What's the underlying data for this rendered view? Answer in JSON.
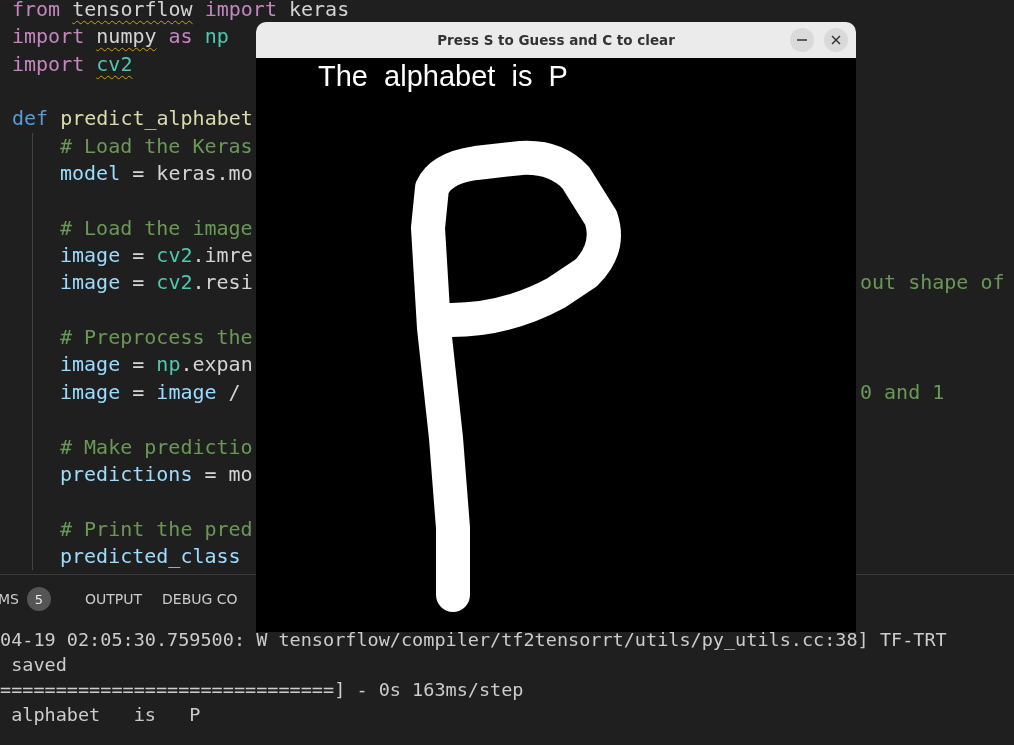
{
  "code": [
    {
      "kind": "code",
      "segments": [
        {
          "text": "from ",
          "kind": "keyword"
        },
        {
          "text": "tensorflow",
          "squiggle": true
        },
        {
          "text": " import ",
          "kind": "keyword"
        },
        {
          "text": "keras"
        }
      ]
    },
    {
      "kind": "code",
      "segments": [
        {
          "text": "import ",
          "kind": "keyword"
        },
        {
          "text": "numpy",
          "squiggle": true
        },
        {
          "text": " as ",
          "kind": "keyword"
        },
        {
          "text": "np",
          "kind": "module"
        }
      ]
    },
    {
      "kind": "code",
      "segments": [
        {
          "text": "import ",
          "kind": "keyword"
        },
        {
          "text": "cv2",
          "kind": "module",
          "squiggle": true
        }
      ]
    },
    {
      "kind": "blank"
    },
    {
      "kind": "code",
      "segments": [
        {
          "text": "def ",
          "kind": "def"
        },
        {
          "text": "predict_alphabet",
          "kind": "func"
        }
      ],
      "children": [
        {
          "kind": "code",
          "segments": [
            {
              "text": "# Load the Keras",
              "kind": "comment"
            }
          ]
        },
        {
          "kind": "code",
          "segments": [
            {
              "text": "model",
              "kind": "var"
            },
            {
              "text": " = keras.mo"
            }
          ]
        },
        {
          "kind": "blank"
        },
        {
          "kind": "code",
          "segments": [
            {
              "text": "# Load the image",
              "kind": "comment"
            }
          ]
        },
        {
          "kind": "code",
          "segments": [
            {
              "text": "image",
              "kind": "var"
            },
            {
              "text": " = "
            },
            {
              "text": "cv2",
              "kind": "module"
            },
            {
              "text": ".imre"
            }
          ]
        },
        {
          "kind": "code",
          "segments": [
            {
              "text": "image",
              "kind": "var"
            },
            {
              "text": " = "
            },
            {
              "text": "cv2",
              "kind": "module"
            },
            {
              "text": ".resi"
            }
          ],
          "tail": "out shape of"
        },
        {
          "kind": "blank"
        },
        {
          "kind": "code",
          "segments": [
            {
              "text": "# Preprocess the",
              "kind": "comment"
            }
          ]
        },
        {
          "kind": "code",
          "segments": [
            {
              "text": "image",
              "kind": "var"
            },
            {
              "text": " = "
            },
            {
              "text": "np",
              "kind": "module"
            },
            {
              "text": ".expan"
            }
          ]
        },
        {
          "kind": "code",
          "segments": [
            {
              "text": "image",
              "kind": "var"
            },
            {
              "text": " = "
            },
            {
              "text": "image",
              "kind": "var"
            },
            {
              "text": " /"
            }
          ],
          "tail": "0 and 1"
        },
        {
          "kind": "blank"
        },
        {
          "kind": "code",
          "segments": [
            {
              "text": "# Make predictio",
              "kind": "comment"
            }
          ]
        },
        {
          "kind": "code",
          "segments": [
            {
              "text": "predictions",
              "kind": "var"
            },
            {
              "text": " = mo"
            }
          ]
        },
        {
          "kind": "blank"
        },
        {
          "kind": "code",
          "segments": [
            {
              "text": "# Print the pred",
              "kind": "comment"
            }
          ]
        },
        {
          "kind": "code",
          "segments": [
            {
              "text": "predicted_class",
              "kind": "var"
            }
          ]
        }
      ]
    }
  ],
  "panel": {
    "tabs": [
      {
        "label": "MS",
        "badge": "5"
      },
      {
        "label": "OUTPUT"
      },
      {
        "label": "DEBUG CO"
      }
    ],
    "terminal": [
      "04-19 02:05:30.759500: W tensorflow/compiler/tf2tensorrt/utils/py_utils.cc:38] TF-TRT",
      " saved",
      "==============================] - 0s 163ms/step",
      " alphabet   is   P"
    ]
  },
  "window": {
    "title": "Press S to Guess and C to clear",
    "canvas_text": "The  alphabet  is  P"
  }
}
